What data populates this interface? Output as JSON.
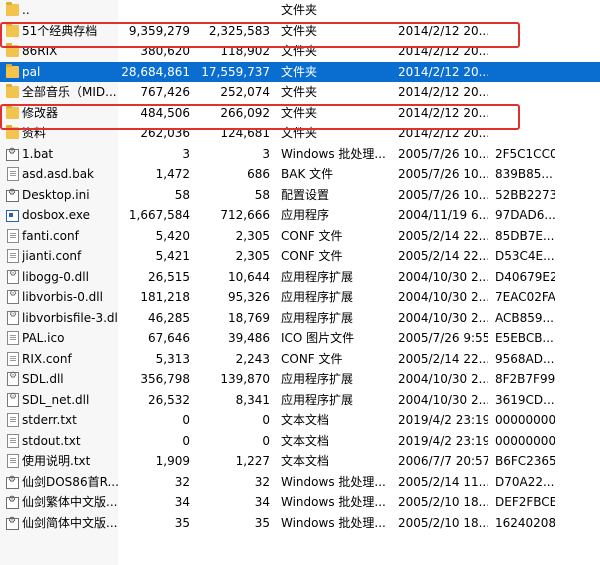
{
  "files": [
    {
      "icon": "folder-icon",
      "name": "..",
      "size": "",
      "packed": "",
      "type": "文件夹",
      "modified": "",
      "crc": ""
    },
    {
      "icon": "folder-icon",
      "name": "51个经典存档",
      "size": "9,359,279",
      "packed": "2,325,583",
      "type": "文件夹",
      "modified": "2014/2/12 20...",
      "crc": ""
    },
    {
      "icon": "folder-icon",
      "name": "86RIX",
      "size": "380,620",
      "packed": "118,902",
      "type": "文件夹",
      "modified": "2014/2/12 20...",
      "crc": ""
    },
    {
      "icon": "folder-icon",
      "name": "pal",
      "size": "28,684,861",
      "packed": "17,559,737",
      "type": "文件夹",
      "modified": "2014/2/12 20...",
      "crc": ""
    },
    {
      "icon": "folder-icon",
      "name": "全部音乐（MID...",
      "size": "767,426",
      "packed": "252,074",
      "type": "文件夹",
      "modified": "2014/2/12 20...",
      "crc": ""
    },
    {
      "icon": "folder-icon",
      "name": "修改器",
      "size": "484,506",
      "packed": "266,092",
      "type": "文件夹",
      "modified": "2014/2/12 20...",
      "crc": ""
    },
    {
      "icon": "folder-icon",
      "name": "资料",
      "size": "262,036",
      "packed": "124,681",
      "type": "文件夹",
      "modified": "2014/2/12 20...",
      "crc": ""
    },
    {
      "icon": "batch-file-icon",
      "name": "1.bat",
      "size": "3",
      "packed": "3",
      "type": "Windows 批处理...",
      "modified": "2005/7/26 10...",
      "crc": "2F5C1CC0"
    },
    {
      "icon": "file-icon",
      "name": "asd.asd.bak",
      "size": "1,472",
      "packed": "686",
      "type": "BAK 文件",
      "modified": "2005/7/26 10...",
      "crc": "839B85..."
    },
    {
      "icon": "settings-file-icon",
      "name": "Desktop.ini",
      "size": "58",
      "packed": "58",
      "type": "配置设置",
      "modified": "2005/7/26 10...",
      "crc": "52BB2273"
    },
    {
      "icon": "exe-icon",
      "name": "dosbox.exe",
      "size": "1,667,584",
      "packed": "712,666",
      "type": "应用程序",
      "modified": "2004/11/19 6...",
      "crc": "97DAD6..."
    },
    {
      "icon": "file-icon",
      "name": "fanti.conf",
      "size": "5,420",
      "packed": "2,305",
      "type": "CONF 文件",
      "modified": "2005/2/14 22...",
      "crc": "85DB7E..."
    },
    {
      "icon": "file-icon",
      "name": "jianti.conf",
      "size": "5,421",
      "packed": "2,305",
      "type": "CONF 文件",
      "modified": "2005/2/14 22...",
      "crc": "D53C4E..."
    },
    {
      "icon": "dll-icon",
      "name": "libogg-0.dll",
      "size": "26,515",
      "packed": "10,644",
      "type": "应用程序扩展",
      "modified": "2004/10/30 2...",
      "crc": "D40679E2"
    },
    {
      "icon": "dll-icon",
      "name": "libvorbis-0.dll",
      "size": "181,218",
      "packed": "95,326",
      "type": "应用程序扩展",
      "modified": "2004/10/30 2...",
      "crc": "7EAC02FA"
    },
    {
      "icon": "dll-icon",
      "name": "libvorbisfile-3.dll",
      "size": "46,285",
      "packed": "18,769",
      "type": "应用程序扩展",
      "modified": "2004/10/30 2...",
      "crc": "ACB859..."
    },
    {
      "icon": "file-icon",
      "name": "PAL.ico",
      "size": "67,646",
      "packed": "39,486",
      "type": "ICO 图片文件",
      "modified": "2005/7/26 9:55",
      "crc": "E5EBCB..."
    },
    {
      "icon": "file-icon",
      "name": "RIX.conf",
      "size": "5,313",
      "packed": "2,243",
      "type": "CONF 文件",
      "modified": "2005/2/14 22...",
      "crc": "9568AD..."
    },
    {
      "icon": "dll-icon",
      "name": "SDL.dll",
      "size": "356,798",
      "packed": "139,870",
      "type": "应用程序扩展",
      "modified": "2004/10/30 2...",
      "crc": "8F2B7F99"
    },
    {
      "icon": "dll-icon",
      "name": "SDL_net.dll",
      "size": "26,532",
      "packed": "8,341",
      "type": "应用程序扩展",
      "modified": "2004/10/30 2...",
      "crc": "3619CD..."
    },
    {
      "icon": "file-icon",
      "name": "stderr.txt",
      "size": "0",
      "packed": "0",
      "type": "文本文档",
      "modified": "2019/4/2 23:19",
      "crc": "00000000"
    },
    {
      "icon": "file-icon",
      "name": "stdout.txt",
      "size": "0",
      "packed": "0",
      "type": "文本文档",
      "modified": "2019/4/2 23:19",
      "crc": "00000000"
    },
    {
      "icon": "file-icon",
      "name": "使用说明.txt",
      "size": "1,909",
      "packed": "1,227",
      "type": "文本文档",
      "modified": "2006/7/7 20:57",
      "crc": "B6FC2365"
    },
    {
      "icon": "batch-file-icon",
      "name": "仙剑DOS86首R...",
      "size": "32",
      "packed": "32",
      "type": "Windows 批处理...",
      "modified": "2005/2/14 11...",
      "crc": "D70A22..."
    },
    {
      "icon": "batch-file-icon",
      "name": "仙剑繁体中文版...",
      "size": "34",
      "packed": "34",
      "type": "Windows 批处理...",
      "modified": "2005/2/10 18...",
      "crc": "DEF2FBCE"
    },
    {
      "icon": "batch-file-icon",
      "name": "仙剑简体中文版...",
      "size": "35",
      "packed": "35",
      "type": "Windows 批处理...",
      "modified": "2005/2/10 18...",
      "crc": "16240208"
    }
  ],
  "selected_row": 3,
  "highlighted_rows": [
    1,
    5
  ],
  "colors": {
    "selection": "#0a6ed1",
    "highlight_border": "#e03030",
    "folder": "#f2c34d"
  }
}
